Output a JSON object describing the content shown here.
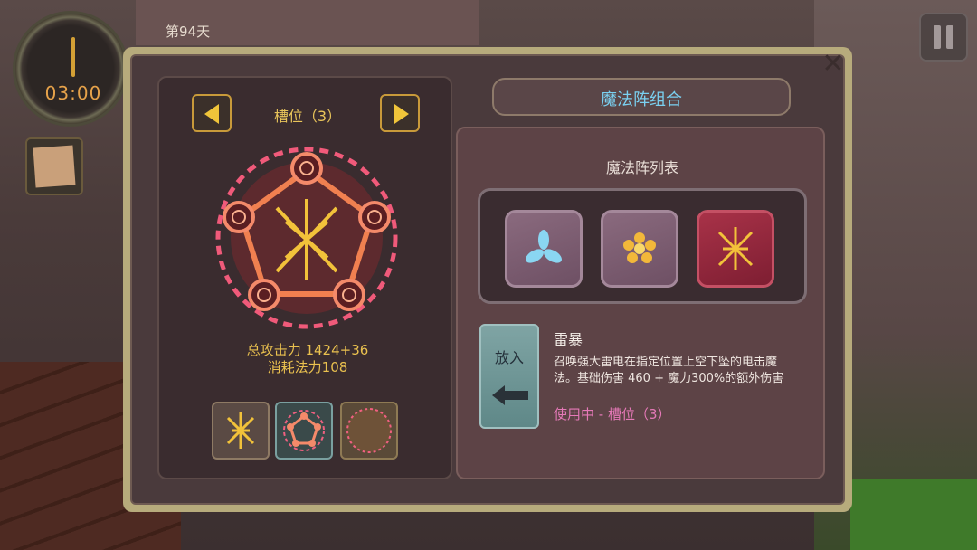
{
  "hud": {
    "clock_time": "03:00",
    "day": "第94天",
    "pause_icon": "pause-icon",
    "note_icon": "scroll-note-icon"
  },
  "dialog": {
    "close_icon": "close-icon",
    "left": {
      "slot_title": "槽位（3）",
      "prev_icon": "arrow-left-icon",
      "next_icon": "arrow-right-icon",
      "total_attack": "总攻击力 1424+36",
      "mana_cost": "消耗法力108",
      "slot_thumbs": [
        "lightning-rune-icon",
        "pentagram-circle-icon",
        "empty-circle-icon"
      ]
    },
    "right": {
      "combo_title": "魔法阵组合",
      "list_title": "魔法阵列表",
      "tiles": [
        {
          "icon": "triskelion-icon",
          "selected": false
        },
        {
          "icon": "flower-icon",
          "selected": false
        },
        {
          "icon": "lightning-rune-icon",
          "selected": true
        }
      ],
      "insert_label": "放入",
      "spell_name": "雷暴",
      "spell_desc": "召唤强大雷电在指定位置上空下坠的电击魔法。基础伤害 460 + 魔力300%的额外伤害",
      "spell_status": "使用中 - 槽位（3）"
    }
  },
  "colors": {
    "accent_gold": "#e8c45a",
    "title_blue": "#7ad0f0",
    "status_pink": "#e679b8",
    "selected_red": "#a83248"
  }
}
